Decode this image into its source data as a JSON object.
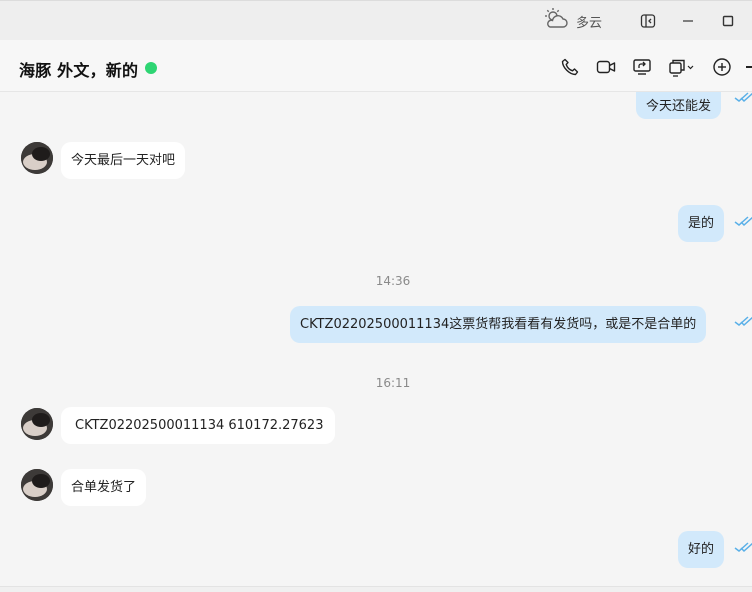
{
  "titlebar": {
    "weather_icon": "cloudy-sun-icon",
    "weather_text": "多云"
  },
  "header": {
    "title": "海豚 外文，新的",
    "status_color": "#2ed573",
    "icons": [
      "phone-icon",
      "video-icon",
      "screen-share-icon",
      "multi-window-icon",
      "add-icon"
    ]
  },
  "messages": [
    {
      "direction": "out",
      "text": "今天还能发"
    },
    {
      "direction": "in",
      "text": "今天最后一天对吧"
    },
    {
      "direction": "out",
      "text": "是的"
    },
    {
      "type": "time",
      "text": "14:36"
    },
    {
      "direction": "out",
      "text": "CKTZ02202500011134这票货帮我看看有发货吗，或是不是合单的"
    },
    {
      "type": "time",
      "text": "16:11"
    },
    {
      "direction": "in",
      "text": "CKTZ02202500011134 610172.27623"
    },
    {
      "direction": "in",
      "text": "合单发货了"
    },
    {
      "direction": "out",
      "text": "好的"
    }
  ],
  "colors": {
    "outgoing_bubble": "#d2e9fb",
    "incoming_bubble": "#ffffff",
    "background": "#f5f5f5",
    "read_receipt": "#5ab0e8"
  }
}
